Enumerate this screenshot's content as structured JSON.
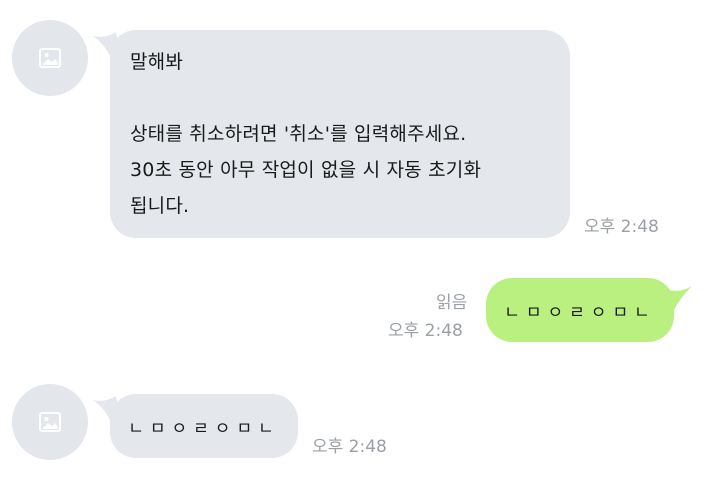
{
  "messages": [
    {
      "side": "left",
      "text": "말해봐\n\n상태를 취소하려면 '취소'를 입력해주세요.\n30초 동안 아무 작업이 없을 시 자동 초기화\n됩니다.",
      "time": "오후 2:48"
    },
    {
      "side": "right",
      "text": "ㄴㅁㅇㄹㅇㅁㄴ",
      "time": "오후 2:48",
      "read_label": "읽음"
    },
    {
      "side": "left",
      "text": "ㄴㅁㅇㄹㅇㅁㄴ",
      "time": "오후 2:48"
    }
  ],
  "icons": {
    "avatar_placeholder": "image-placeholder-icon"
  },
  "colors": {
    "incoming_bubble": "#e4e7eb",
    "outgoing_bubble": "#b9f07f",
    "avatar_bg": "#e3e6ea",
    "meta_text": "#9aa0a6"
  }
}
